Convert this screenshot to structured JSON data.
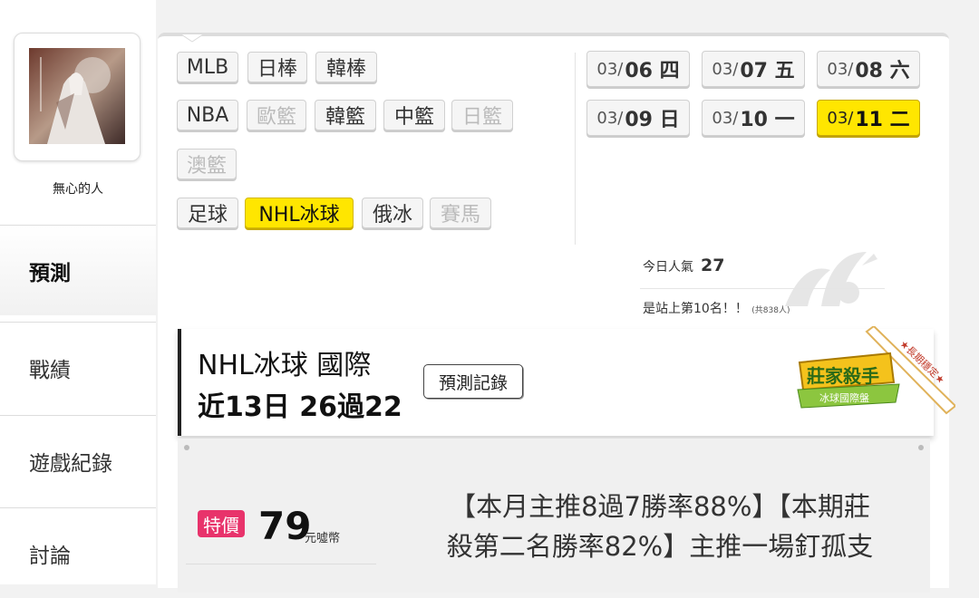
{
  "user": {
    "name": "無心的人"
  },
  "nav": {
    "predict": "預測",
    "record": "戰績",
    "games": "遊戲紀錄",
    "discuss": "討論"
  },
  "sports": [
    {
      "label": "MLB",
      "state": "normal"
    },
    {
      "label": "日棒",
      "state": "normal"
    },
    {
      "label": "韓棒",
      "state": "normal"
    },
    {
      "label": "NBA",
      "state": "normal"
    },
    {
      "label": "歐籃",
      "state": "disabled"
    },
    {
      "label": "韓籃",
      "state": "normal"
    },
    {
      "label": "中籃",
      "state": "normal"
    },
    {
      "label": "日籃",
      "state": "disabled"
    },
    {
      "label": "澳籃",
      "state": "disabled"
    },
    {
      "label": "足球",
      "state": "normal"
    },
    {
      "label": "NHL冰球",
      "state": "selected"
    },
    {
      "label": "俄冰",
      "state": "normal"
    },
    {
      "label": "賽馬",
      "state": "disabled"
    }
  ],
  "dates": [
    {
      "md": "03/",
      "dd": "06 四"
    },
    {
      "md": "03/",
      "dd": "07 五"
    },
    {
      "md": "03/",
      "dd": "08 六"
    },
    {
      "md": "03/",
      "dd": "09 日"
    },
    {
      "md": "03/",
      "dd": "10 一"
    },
    {
      "md": "03/",
      "dd": "11 二",
      "selected": true
    }
  ],
  "stats": {
    "popularity_label": "今日人氣",
    "popularity_value": "27",
    "rank_text": "是站上第10名！！",
    "rank_total": "(共838人)"
  },
  "header": {
    "title": "NHL冰球 國際",
    "subtitle": "近13日 26過22",
    "record_button": "預測記錄"
  },
  "badge": {
    "main": "莊家殺手",
    "sub": "冰球國際盤",
    "ribbon": "★長期穩定★"
  },
  "offer": {
    "tag": "特價",
    "price": "79",
    "unit": "元噓幣",
    "desc_line1": "【本月主推8過7勝率88%】【本期莊",
    "desc_line2": "殺第二名勝率82%】主推一場釘孤支"
  },
  "colors": {
    "accent_yellow": "#ffe600",
    "tag_pink": "#e8336b",
    "badge_green": "#8cc63f"
  }
}
